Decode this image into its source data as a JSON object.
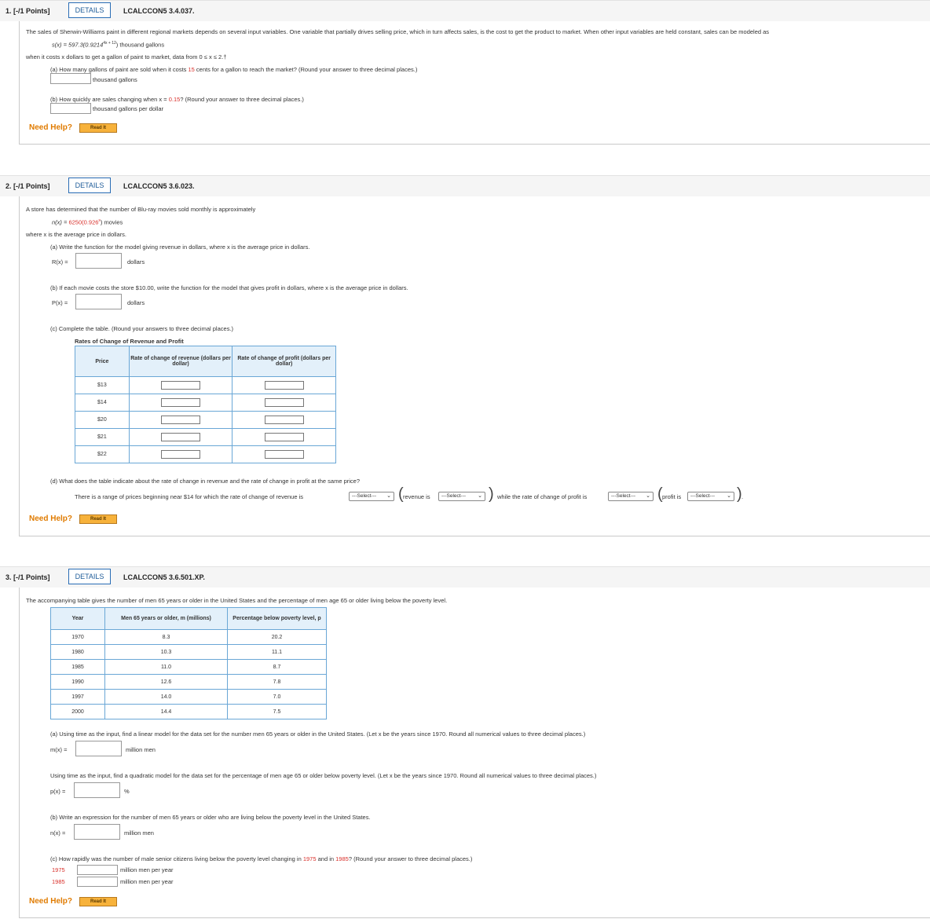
{
  "colors": {
    "accent": "#2a6db5",
    "need_help": "#e07b00",
    "red": "#d9302b",
    "table_border": "#6aa7d6",
    "table_header": "#e3f0fa"
  },
  "common": {
    "details_label": "DETAILS",
    "need_help": "Need Help?",
    "read_it": "Read It",
    "select_placeholder": "---Select---"
  },
  "q1": {
    "number": "1. [-/1 Points]",
    "code": "LCALCCON5 3.4.037.",
    "intro": "The sales of Sherwin-Williams paint in different regional markets depends on several input variables. One variable that partially drives selling price, which in turn affects sales, is the cost to get the product to market. When other input variables are held constant, sales can be modeled as",
    "model_pre": "s(x) = 597.3(0.9214",
    "model_exp": "4x + 12",
    "model_post": ") thousand gallons",
    "domain": "when it costs x dollars to get a gallon of paint to market, data from  0 ≤ x ≤ 2.†",
    "a_pre": "(a) How many gallons of paint are sold when it costs ",
    "a_red": "15",
    "a_post": " cents for a gallon to reach the market? (Round your answer to three decimal places.)",
    "a_unit": "thousand gallons",
    "b_pre": "(b) How quickly are sales changing when x = ",
    "b_red": "0.15",
    "b_post": "? (Round your answer to three decimal places.)",
    "b_unit": "thousand gallons per dollar"
  },
  "q2": {
    "number": "2. [-/1 Points]",
    "code": "LCALCCON5 3.6.023.",
    "intro": "A store has determined that the number of Blu-ray movies sold monthly is approximately",
    "model_pre": "n(x) = ",
    "model_red": "6250(0.926",
    "model_exp": "x",
    "model_post": ") movies",
    "where": "where x is the average price in dollars.",
    "a": "(a) Write the function for the model giving revenue in dollars, where x is the average price in dollars.",
    "a_label": "R(x) =",
    "a_unit": "dollars",
    "b": "(b) If each movie costs the store $10.00, write the function for the model that gives profit in dollars, where x is the average price in dollars.",
    "b_label": "P(x) =",
    "b_unit": "dollars",
    "c": "(c) Complete the table. (Round your answers to three decimal places.)",
    "table_title": "Rates of Change of Revenue and Profit",
    "table_headers": [
      "Price",
      "Rate of change of revenue (dollars per dollar)",
      "Rate of change of profit (dollars per dollar)"
    ],
    "prices": [
      "$13",
      "$14",
      "$20",
      "$21",
      "$22"
    ],
    "d": "(d) What does the table indicate about the rate of change in revenue and the rate of change in profit at the same price?",
    "d_sentence": "There is a range of prices beginning near $14 for which the rate of change of revenue is",
    "d_revenue_is": "revenue is",
    "d_while": "while the rate of change of profit is",
    "d_profit_is": "profit is",
    "d_end": "."
  },
  "q3": {
    "number": "3. [-/1 Points]",
    "code": "LCALCCON5 3.6.501.XP.",
    "intro": "The accompanying table gives the number of men 65 years or older in the United States and the percentage of men age 65 or older living below the poverty level.",
    "table_headers": [
      "Year",
      "Men 65 years or older, m (millions)",
      "Percentage below poverty level, p"
    ],
    "rows": [
      [
        "1970",
        "8.3",
        "20.2"
      ],
      [
        "1980",
        "10.3",
        "11.1"
      ],
      [
        "1985",
        "11.0",
        "8.7"
      ],
      [
        "1990",
        "12.6",
        "7.8"
      ],
      [
        "1997",
        "14.0",
        "7.0"
      ],
      [
        "2000",
        "14.4",
        "7.5"
      ]
    ],
    "a": "(a) Using time as the input, find a linear model for the data set for the number men 65 years or older in the United States. (Let x be the years since 1970. Round all numerical values to three decimal places.)",
    "a_label": "m(x) =",
    "a_unit": "million men",
    "a2": "Using time as the input, find a quadratic model for the data set for the percentage of men age 65 or older below poverty level. (Let x be the years since 1970. Round all numerical values to three decimal places.)",
    "a2_label": "p(x) =",
    "a2_unit": "%",
    "b": "(b) Write an expression for the number of men 65 years or older who are living below the poverty level in the United States.",
    "b_label": "n(x) =",
    "b_unit": "million men",
    "c_pre": "(c) How rapidly was the number of male senior citizens living below the poverty level changing in ",
    "c_red1": "1975",
    "c_mid": " and in ",
    "c_red2": "1985",
    "c_post": "? (Round your answer to three decimal places.)",
    "c_row1": "1975",
    "c_row2": "1985",
    "c_unit": "million men per year"
  }
}
